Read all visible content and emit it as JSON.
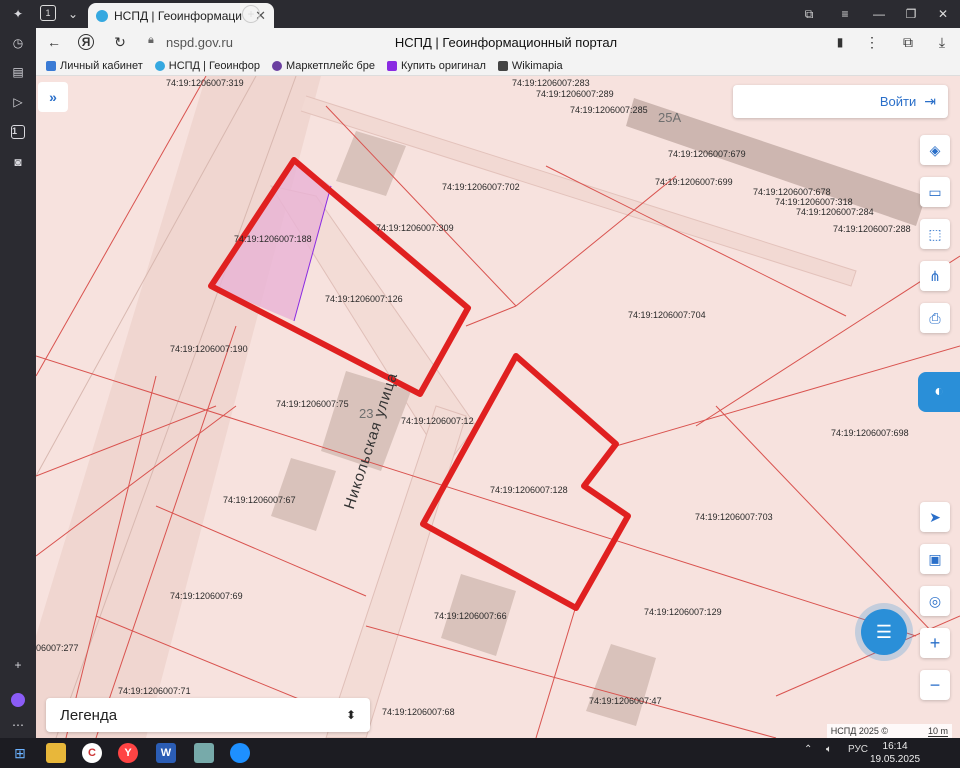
{
  "browser": {
    "tab_count": "1",
    "tab_title": "НСПД | Геоинформаци",
    "url_domain": "nspd.gov.ru",
    "page_title": "НСПД | Геоинформационный портал",
    "bookmarks": [
      {
        "label": "Личный кабинет",
        "color": "#3a7bd5"
      },
      {
        "label": "НСПД | Геоинфор",
        "color": "#35a8e0"
      },
      {
        "label": "Маркетплейс бре",
        "color": "#6b3fa0"
      },
      {
        "label": "Купить оригинал",
        "color": "#8a2be2"
      },
      {
        "label": "Wikimapia",
        "color": "#444444"
      }
    ]
  },
  "map": {
    "login_label": "Войти",
    "legend_label": "Легенда",
    "copyright": "НСПД 2025 ©",
    "scale_label": "10 m",
    "street_label": "Никольская улица",
    "building_numbers": [
      "25А",
      "23"
    ],
    "parcel_labels": [
      "74:19:1206007:319",
      "74:19:1206007:283",
      "74:19:1206007:289",
      "74:19:1206007:285",
      "74:19:1206007:679",
      "74:19:1206007:699",
      "74:19:1206007:678",
      "74:19:1206007:318",
      "74:19:1206007:284",
      "74:19:1206007:288",
      "74:19:1206007:702",
      "74:19:1206007:309",
      "74:19:1206007:188",
      "74:19:1206007:126",
      "74:19:1206007:704",
      "74:19:1206007:190",
      "74:19:1206007:75",
      "74:19:1206007:12",
      "74:19:1206007:698",
      "74:19:1206007:128",
      "74:19:1206007:67",
      "74:19:1206007:703",
      "74:19:1206007:69",
      "74:19:1206007:66",
      "74:19:1206007:129",
      "06007:277",
      "74:19:1206007:71",
      "74:19:1206007:47",
      "74:19:1206007:68"
    ]
  },
  "taskbar": {
    "lang": "РУС",
    "time": "16:14",
    "date": "19.05.2025"
  }
}
